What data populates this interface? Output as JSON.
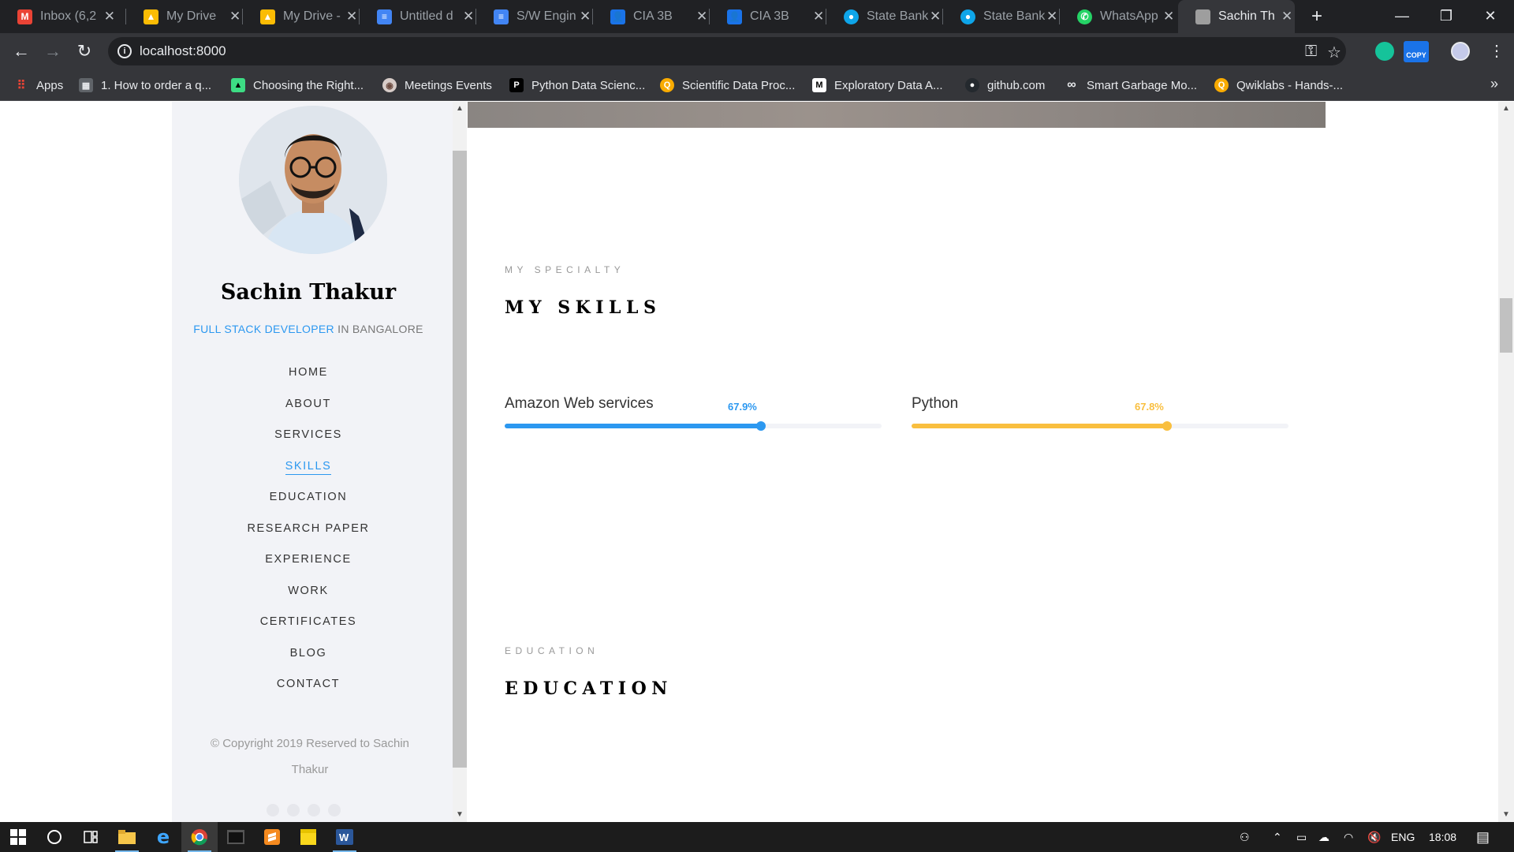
{
  "browser": {
    "tabs": [
      {
        "title": "Inbox (6,2",
        "icon": "gmail-icon",
        "color": "#ea4335"
      },
      {
        "title": "My Drive",
        "icon": "google-drive-icon",
        "color": "#fbbc04"
      },
      {
        "title": "My Drive -",
        "icon": "google-drive-icon",
        "color": "#fbbc04"
      },
      {
        "title": "Untitled d",
        "icon": "google-docs-icon",
        "color": "#4285f4"
      },
      {
        "title": "S/W Engin",
        "icon": "google-docs-icon",
        "color": "#4285f4"
      },
      {
        "title": "CIA 3B",
        "icon": "google-classroom-icon",
        "color": "#1a73e8"
      },
      {
        "title": "CIA 3B",
        "icon": "google-classroom-icon",
        "color": "#1a73e8"
      },
      {
        "title": "State Bank",
        "icon": "sbi-icon",
        "color": "#0ea5e9"
      },
      {
        "title": "State Bank",
        "icon": "sbi-icon",
        "color": "#0ea5e9"
      },
      {
        "title": "WhatsApp",
        "icon": "whatsapp-icon",
        "color": "#25d366"
      },
      {
        "title": "Sachin Th",
        "icon": "profile-photo-icon",
        "color": "#9e9e9e",
        "active": true
      }
    ],
    "url": "localhost:8000",
    "bookmarks": [
      {
        "label": "Apps",
        "icon": "apps-grid-icon"
      },
      {
        "label": "1. How to order a q...",
        "icon": "bookmark-page-icon"
      },
      {
        "label": "Choosing the Right...",
        "icon": "android-icon"
      },
      {
        "label": "Meetings Events",
        "icon": "meetings-icon"
      },
      {
        "label": "Python Data Scienc...",
        "icon": "packt-icon"
      },
      {
        "label": "Scientific Data Proc...",
        "icon": "coursera-icon"
      },
      {
        "label": "Exploratory Data A...",
        "icon": "medium-icon"
      },
      {
        "label": "github.com",
        "icon": "github-icon"
      },
      {
        "label": "Smart Garbage Mo...",
        "icon": "infinity-icon"
      },
      {
        "label": "Qwiklabs - Hands-...",
        "icon": "qwiklabs-icon"
      }
    ],
    "extension_badge": "COPY"
  },
  "sidebar": {
    "name": "Sachin Thakur",
    "tagline_accent": "FULL STACK DEVELOPER",
    "tagline_rest": " IN BANGALORE",
    "nav": [
      {
        "label": "HOME"
      },
      {
        "label": "ABOUT"
      },
      {
        "label": "SERVICES"
      },
      {
        "label": "SKILLS",
        "active": true
      },
      {
        "label": "EDUCATION"
      },
      {
        "label": "RESEARCH PAPER"
      },
      {
        "label": "EXPERIENCE"
      },
      {
        "label": "WORK"
      },
      {
        "label": "CERTIFICATES"
      },
      {
        "label": "BLOG"
      },
      {
        "label": "CONTACT"
      }
    ],
    "copyright": "© Copyright 2019 Reserved to Sachin Thakur"
  },
  "skills_section": {
    "eyebrow": "MY SPECIALTY",
    "title": "MY SKILLS",
    "skills": [
      {
        "name": "Amazon Web services",
        "percent": 67.9,
        "percent_label": "67.9%",
        "color": "#2c98f0"
      },
      {
        "name": "Python",
        "percent": 67.8,
        "percent_label": "67.8%",
        "color": "#f9bf3f"
      }
    ]
  },
  "education_section": {
    "eyebrow": "EDUCATION",
    "title": "EDUCATION"
  },
  "taskbar": {
    "language": "ENG",
    "time": "18:08"
  }
}
